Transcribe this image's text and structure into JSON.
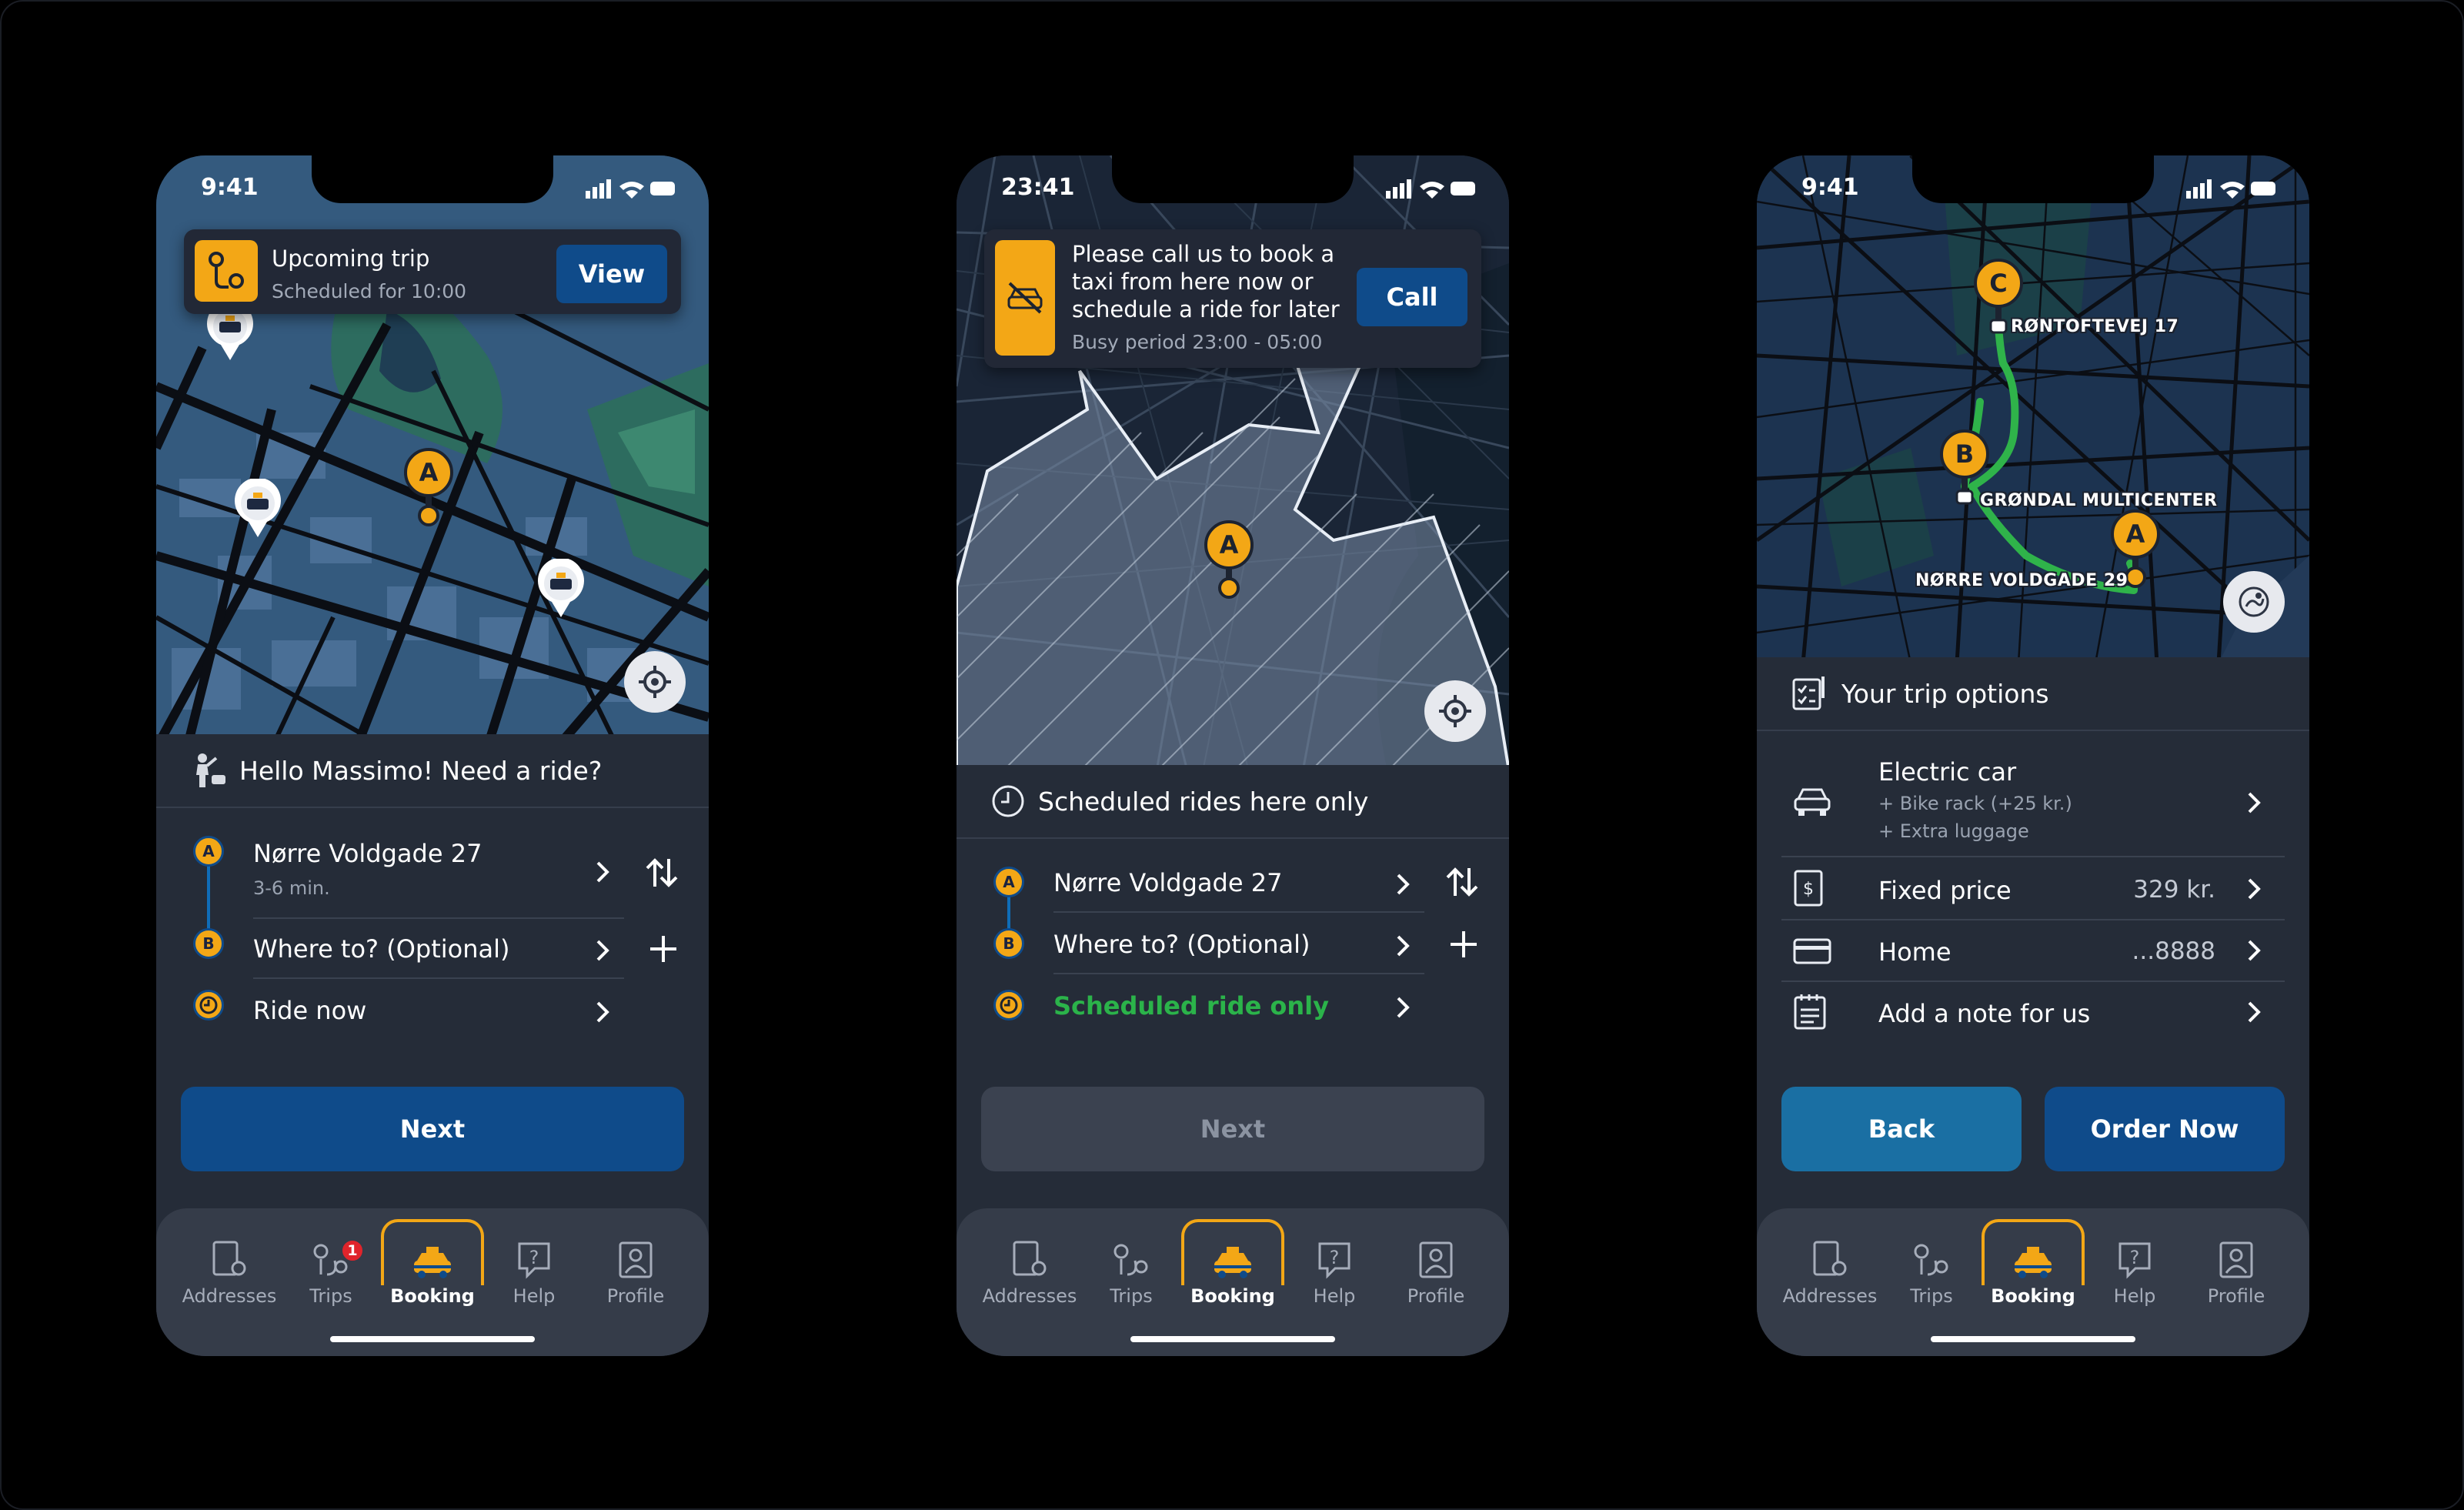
{
  "status": {
    "time_day": "9:41",
    "time_night": "23:41"
  },
  "screen1": {
    "banner": {
      "title": "Upcoming trip",
      "subtitle": "Scheduled for 10:00",
      "button": "View"
    },
    "greeting": "Hello Massimo! Need a ride?",
    "pickup": {
      "marker": "A",
      "address": "Nørre Voldgade 27",
      "eta": "3-6 min."
    },
    "destination": {
      "marker": "B",
      "placeholder": "Where to? (Optional)"
    },
    "when": "Ride now",
    "cta": "Next"
  },
  "screen2": {
    "banner": {
      "title": "Please call us to book a taxi from here now or schedule a ride for later",
      "subtitle": "Busy period 23:00 - 05:00",
      "button": "Call"
    },
    "notice": "Scheduled rides here only",
    "pickup": {
      "marker": "A",
      "address": "Nørre Voldgade 27"
    },
    "destination": {
      "marker": "B",
      "placeholder": "Where to? (Optional)"
    },
    "when": "Scheduled ride only",
    "cta": "Next"
  },
  "screen3": {
    "map_labels": {
      "c": "RØNTOFTEVEJ 17",
      "b": "GRØNDAL MULTICENTER",
      "a": "NØRRE VOLDGADE 29"
    },
    "markers": [
      "A",
      "B",
      "C"
    ],
    "title": "Your trip options",
    "vehicle": {
      "name": "Electric car",
      "extra1": "+ Bike rack (+25 kr.)",
      "extra2": "+ Extra luggage"
    },
    "price": {
      "label": "Fixed price",
      "value": "329 kr."
    },
    "payment": {
      "label": "Home",
      "value": "...8888"
    },
    "note": {
      "label": "Add a note for us"
    },
    "back": "Back",
    "order": "Order Now"
  },
  "tabs": {
    "addresses": "Addresses",
    "trips": "Trips",
    "booking": "Booking",
    "help": "Help",
    "profile": "Profile",
    "trips_badge": "1"
  },
  "colors": {
    "accent": "#f3a716",
    "primary": "#0f4b8a",
    "panel": "#252c38",
    "success": "#2bb34a",
    "route": "#2fb34a"
  }
}
